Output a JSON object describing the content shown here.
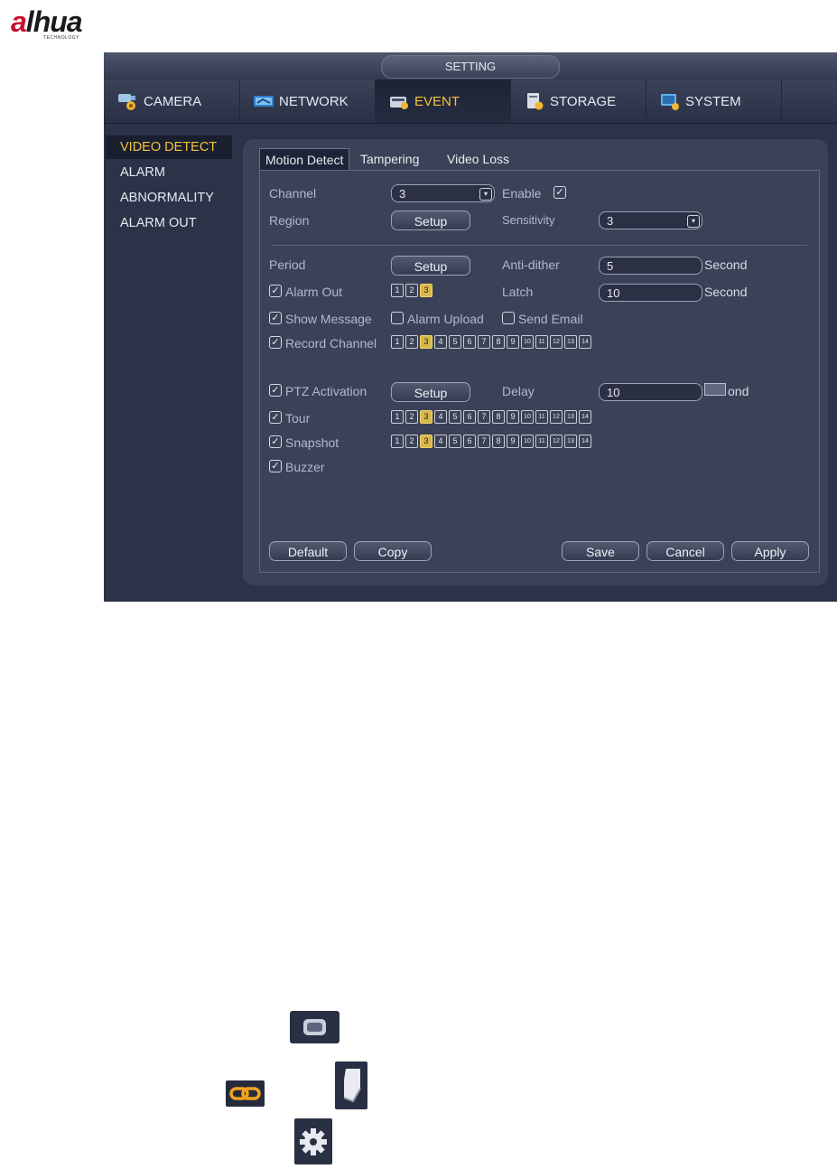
{
  "logo": {
    "brand_a": "a",
    "brand_rest": "lhua",
    "tagline": "TECHNOLOGY"
  },
  "window": {
    "title": "SETTING"
  },
  "tabs": [
    {
      "label": "CAMERA",
      "icon": "camera-icon"
    },
    {
      "label": "NETWORK",
      "icon": "network-icon"
    },
    {
      "label": "EVENT",
      "icon": "event-icon",
      "active": true
    },
    {
      "label": "STORAGE",
      "icon": "storage-icon"
    },
    {
      "label": "SYSTEM",
      "icon": "system-icon"
    }
  ],
  "sidebar": {
    "items": [
      {
        "label": "VIDEO DETECT",
        "active": true
      },
      {
        "label": "ALARM"
      },
      {
        "label": "ABNORMALITY"
      },
      {
        "label": "ALARM OUT"
      }
    ]
  },
  "subtabs": [
    {
      "label": "Motion Detect",
      "active": true
    },
    {
      "label": "Tampering"
    },
    {
      "label": "Video Loss"
    }
  ],
  "form": {
    "channel_label": "Channel",
    "channel_value": "3",
    "enable_label": "Enable",
    "enable_checked": true,
    "region_label": "Region",
    "region_button": "Setup",
    "sensitivity_label": "Sensitivity",
    "sensitivity_value": "3",
    "period_label": "Period",
    "period_button": "Setup",
    "antidither_label": "Anti-dither",
    "antidither_value": "5",
    "antidither_unit": "Second",
    "alarmout_label": "Alarm Out",
    "alarmout_nums": [
      "1",
      "2",
      "3"
    ],
    "alarmout_selected": "3",
    "latch_label": "Latch",
    "latch_value": "10",
    "latch_unit": "Second",
    "showmsg_label": "Show Message",
    "alarmupload_label": "Alarm Upload",
    "sendemail_label": "Send Email",
    "recordchannel_label": "Record Channel",
    "channel_nums": [
      "1",
      "2",
      "3",
      "4",
      "5",
      "6",
      "7",
      "8",
      "9",
      "10",
      "11",
      "12",
      "13",
      "14"
    ],
    "channel_selected": "3",
    "ptz_label": "PTZ Activation",
    "ptz_button": "Setup",
    "delay_label": "Delay",
    "delay_value": "10",
    "delay_unit": "ond",
    "tour_label": "Tour",
    "snapshot_label": "Snapshot",
    "buzzer_label": "Buzzer"
  },
  "buttons": {
    "default": "Default",
    "copy": "Copy",
    "save": "Save",
    "cancel": "Cancel",
    "apply": "Apply"
  },
  "colors": {
    "accent": "#f3c33e",
    "panel": "#3b4257",
    "window": "#2c3348"
  },
  "legend_icons": [
    "rectangle-icon",
    "link-icon",
    "eraser-icon",
    "gear-icon"
  ]
}
